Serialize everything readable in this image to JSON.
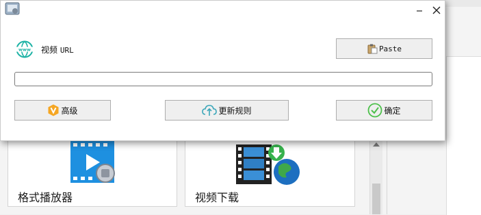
{
  "background": {
    "tiles": [
      {
        "label": "格式播放器",
        "icon": "video-player-icon"
      },
      {
        "label": "视频下载",
        "icon": "film-download-globe-icon"
      }
    ]
  },
  "dialog": {
    "icons": {
      "app": "app-logo-icon",
      "minimize": "minimize-icon",
      "close": "close-icon",
      "url": "www-globe-icon",
      "paste": "clipboard-icon",
      "advanced": "v-shield-icon",
      "update": "cloud-upload-icon",
      "confirm": "check-circle-icon"
    },
    "url_label_cn": "视频",
    "url_label_en": "URL",
    "url_input_value": "",
    "buttons": {
      "paste": "Paste",
      "advanced": "高级",
      "update_rules": "更新规则",
      "confirm": "确定"
    }
  },
  "colors": {
    "globe_teal": "#1fb3a6",
    "shield_orange": "#f5a623",
    "check_green": "#4cc04a",
    "cloud_teal": "#3aa6b9"
  }
}
